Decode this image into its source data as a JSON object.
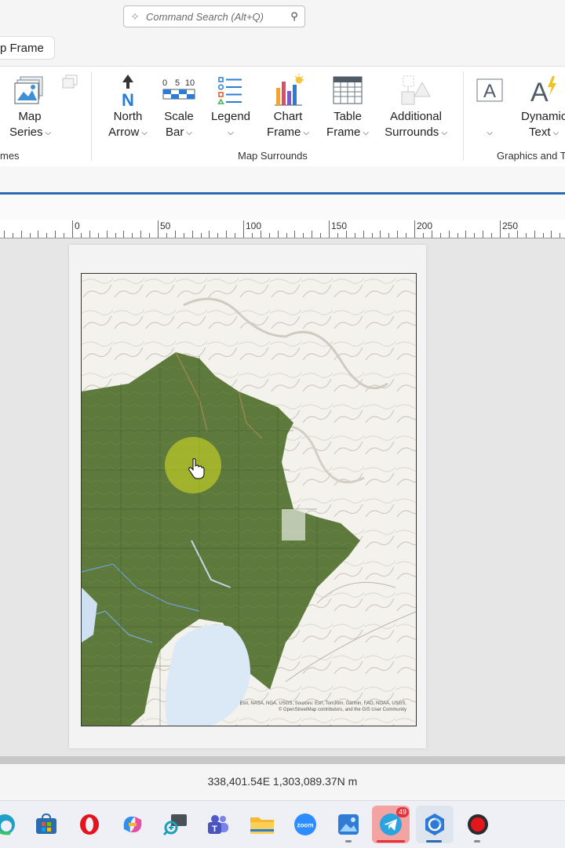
{
  "search": {
    "placeholder": "Command Search (Alt+Q)"
  },
  "tabs": {
    "map_frame": "p Frame"
  },
  "ribbon": {
    "map_series": {
      "line1": "Map",
      "line2": "Series"
    },
    "north_arrow": {
      "line1": "North",
      "line2": "Arrow"
    },
    "scale_bar": {
      "line1": "Scale",
      "line2": "Bar",
      "ticks": [
        "0",
        "5",
        "10"
      ]
    },
    "legend": {
      "line1": "Legend"
    },
    "chart_frame": {
      "line1": "Chart",
      "line2": "Frame"
    },
    "table_frame": {
      "line1": "Table",
      "line2": "Frame"
    },
    "additional_surrounds": {
      "line1": "Additional",
      "line2": "Surrounds"
    },
    "dynamic_text": {
      "line1": "Dynamic",
      "line2": "Text"
    },
    "groups": {
      "frames": "mes",
      "map_surrounds": "Map Surrounds",
      "graphics_text": "Graphics and T"
    }
  },
  "ruler": {
    "labels": [
      "0",
      "50",
      "100",
      "150",
      "200",
      "250"
    ]
  },
  "map": {
    "credits_line1": "Esri, NASA, NGA, USGS, Sources: Esri, TomTom, Garmin, FAO, NOAA, USGS,",
    "credits_line2": "© OpenStreetMap contributors, and the GIS User Community"
  },
  "status": {
    "coordinates": "338,401.54E 1,303,089.37N m"
  },
  "taskbar": {
    "telegram_badge": "49",
    "apps": [
      "edge-icon",
      "store-icon",
      "opera-icon",
      "copilot-icon",
      "screen-tool-icon",
      "teams-icon",
      "file-explorer-icon",
      "zoom-icon",
      "photos-icon",
      "telegram-icon",
      "arcgis-icon",
      "record-icon"
    ]
  }
}
